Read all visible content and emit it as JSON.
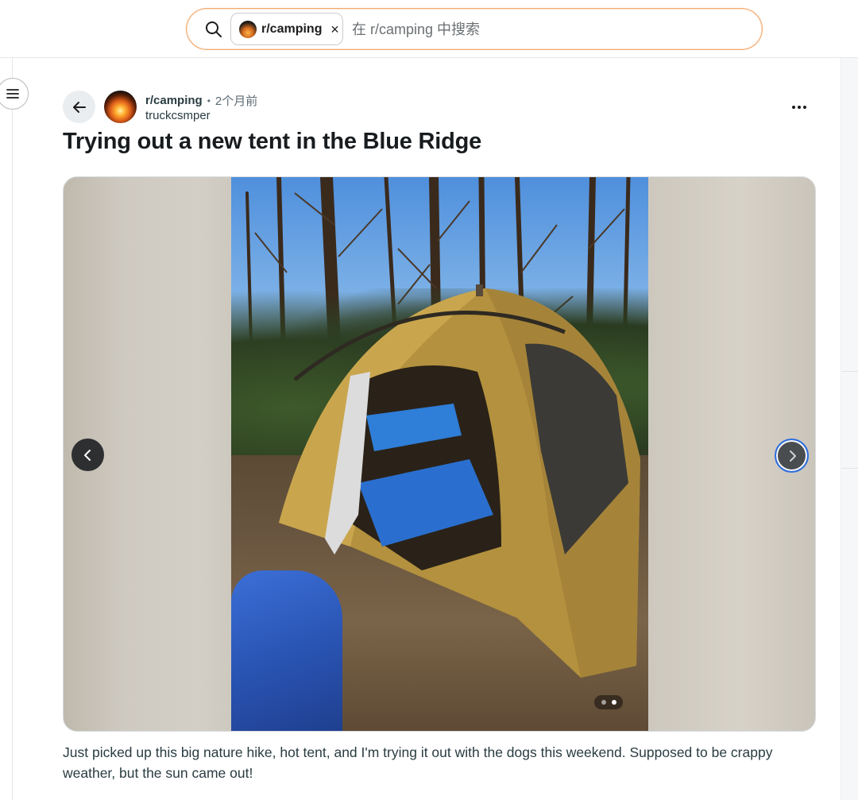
{
  "search": {
    "chip_label": "r/camping",
    "chip_close": "×",
    "placeholder": "在 r/camping 中搜索"
  },
  "post": {
    "subreddit": "r/camping",
    "separator": "•",
    "age": "2个月前",
    "author": "truckcsmper",
    "title": "Trying out a new tent in the Blue Ridge",
    "body": "Just picked up this big nature hike, hot tent, and I'm trying it out with the dogs this weekend. Supposed to be crappy weather, but the sun came out!"
  },
  "gallery": {
    "image_count": 2,
    "current_index": 2
  },
  "icons": {
    "search": "search-icon",
    "menu": "hamburger-menu-icon",
    "back": "arrow-left-icon",
    "more": "more-horizontal-icon",
    "prev": "chevron-left-icon",
    "next": "chevron-right-icon",
    "close": "close-icon"
  },
  "colors": {
    "search_border": "#f2a86b",
    "accent_focus": "#2f6fdf",
    "text_primary": "#181c1f",
    "text_meta": "#5c6c74"
  }
}
